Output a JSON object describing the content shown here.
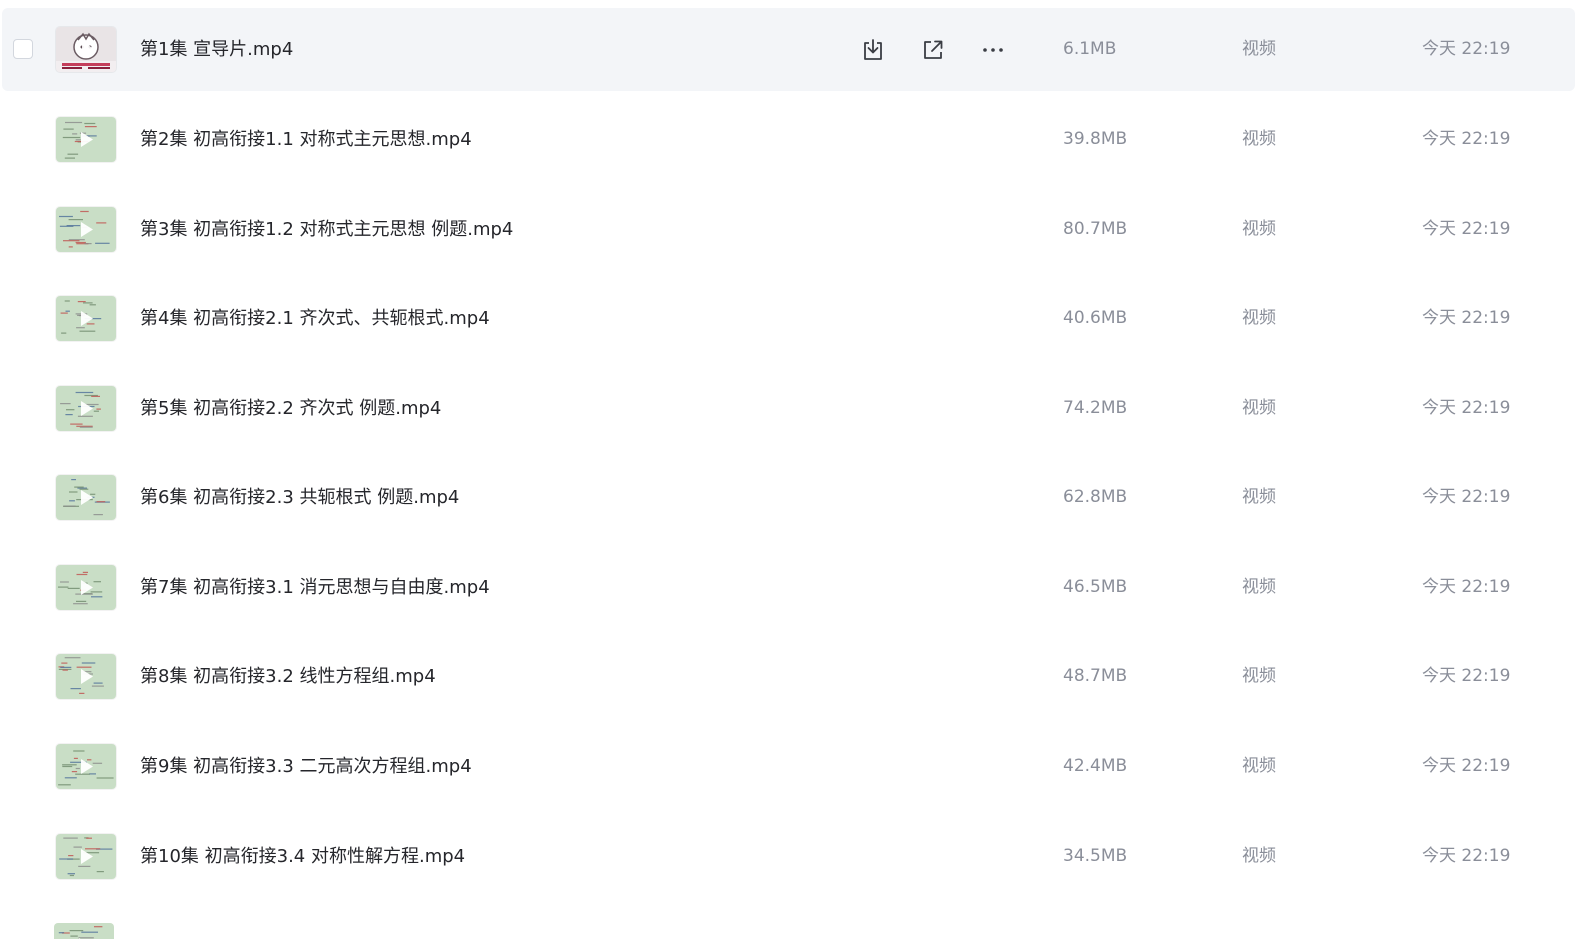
{
  "files": [
    {
      "name": "第1集 宣导片.mp4",
      "size": "6.1MB",
      "type": "视频",
      "time": "今天 22:19",
      "thumb": "logo"
    },
    {
      "name": "第2集 初高衔接1.1 对称式主元思想.mp4",
      "size": "39.8MB",
      "type": "视频",
      "time": "今天 22:19",
      "thumb": "board"
    },
    {
      "name": "第3集 初高衔接1.2 对称式主元思想 例题.mp4",
      "size": "80.7MB",
      "type": "视频",
      "time": "今天 22:19",
      "thumb": "board"
    },
    {
      "name": "第4集 初高衔接2.1 齐次式、共轭根式.mp4",
      "size": "40.6MB",
      "type": "视频",
      "time": "今天 22:19",
      "thumb": "board"
    },
    {
      "name": "第5集 初高衔接2.2 齐次式 例题.mp4",
      "size": "74.2MB",
      "type": "视频",
      "time": "今天 22:19",
      "thumb": "board"
    },
    {
      "name": "第6集 初高衔接2.3 共轭根式 例题.mp4",
      "size": "62.8MB",
      "type": "视频",
      "time": "今天 22:19",
      "thumb": "board"
    },
    {
      "name": "第7集 初高衔接3.1 消元思想与自由度.mp4",
      "size": "46.5MB",
      "type": "视频",
      "time": "今天 22:19",
      "thumb": "board"
    },
    {
      "name": "第8集 初高衔接3.2 线性方程组.mp4",
      "size": "48.7MB",
      "type": "视频",
      "time": "今天 22:19",
      "thumb": "board"
    },
    {
      "name": "第9集 初高衔接3.3 二元高次方程组.mp4",
      "size": "42.4MB",
      "type": "视频",
      "time": "今天 22:19",
      "thumb": "board"
    },
    {
      "name": "第10集 初高衔接3.4 对称性解方程.mp4",
      "size": "34.5MB",
      "type": "视频",
      "time": "今天 22:19",
      "thumb": "board"
    }
  ],
  "hovered_row_actions": [
    "download-icon",
    "share-icon",
    "more-icon"
  ],
  "colors": {
    "hover_bg": "#f3f5f8",
    "name_text": "#25262b",
    "meta_text": "#8a8e99",
    "thumb_green": "#c9dec6",
    "icon": "#3a3d44"
  }
}
